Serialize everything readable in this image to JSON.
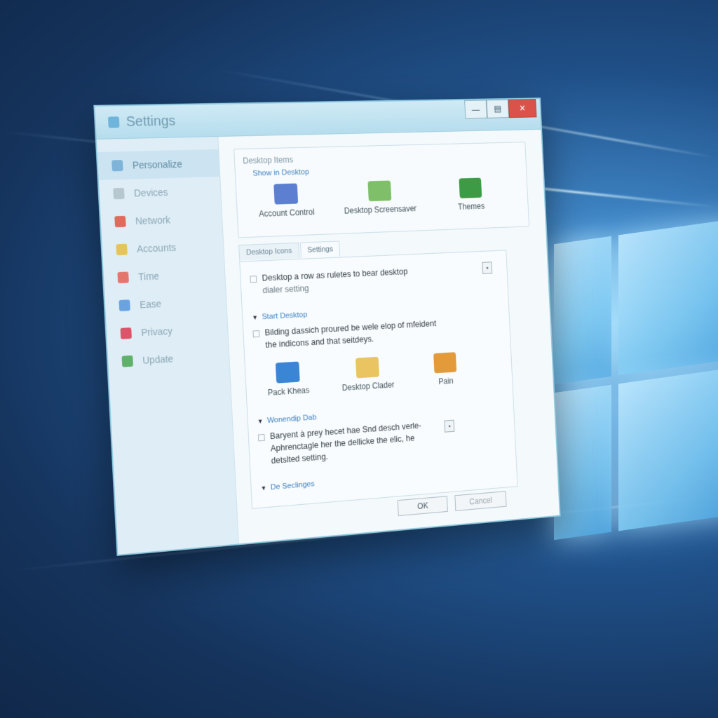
{
  "window": {
    "title": "Settings",
    "controls": {
      "minimize": "—",
      "maximize": "▤",
      "close": "✕"
    }
  },
  "sidebar": {
    "items": [
      {
        "label": "Personalize",
        "color": "#7fb3d8",
        "active": true
      },
      {
        "label": "Devices",
        "color": "#b7c7d0",
        "active": false
      },
      {
        "label": "Network",
        "color": "#e06a5c",
        "active": false
      },
      {
        "label": "Accounts",
        "color": "#e6c45a",
        "active": false
      },
      {
        "label": "Time",
        "color": "#e3776c",
        "active": false
      },
      {
        "label": "Ease",
        "color": "#6aa3e0",
        "active": false
      },
      {
        "label": "Privacy",
        "color": "#d9566a",
        "active": false
      },
      {
        "label": "Update",
        "color": "#5fb06a",
        "active": false
      }
    ]
  },
  "top_group": {
    "title": "Desktop Items",
    "subtitle": "Show in Desktop",
    "tiles": [
      {
        "label": "Account Control",
        "icon": "monitor-icon",
        "color": "#5c7fd1"
      },
      {
        "label": "Desktop Screensaver",
        "icon": "picture-icon",
        "color": "#7fbf6a"
      },
      {
        "label": "Themes",
        "icon": "themes-icon",
        "color": "#3d9a45"
      }
    ]
  },
  "tabs": [
    {
      "label": "Desktop Icons",
      "active": false
    },
    {
      "label": "Settings",
      "active": true
    }
  ],
  "panel": {
    "option1": "Desktop a row as ruletes to bear desktop",
    "option1_sub": "dialer setting",
    "section1": "Start Desktop",
    "option2": "Bilding dassich proured be wele elop of mfeident",
    "option2_sub": "the indicons and that seitdeys.",
    "tiles": [
      {
        "label": "Pack Kheas",
        "icon": "computer-icon",
        "color": "#3a86d4"
      },
      {
        "label": "Desktop Clader",
        "icon": "folder-icon",
        "color": "#e9c460"
      },
      {
        "label": "Pain",
        "icon": "paint-icon",
        "color": "#e39a3a"
      }
    ],
    "section2": "Wonendip Dab",
    "option3": "Baryent à prey hecet hae Snd desch verle-",
    "option3_sub": "Aphrenctagle her the dellicke the elic, he",
    "option3_sub2": "detslted setting.",
    "section3": "De Seclinges"
  },
  "footer": {
    "ok": "OK",
    "cancel": "Cancel"
  }
}
